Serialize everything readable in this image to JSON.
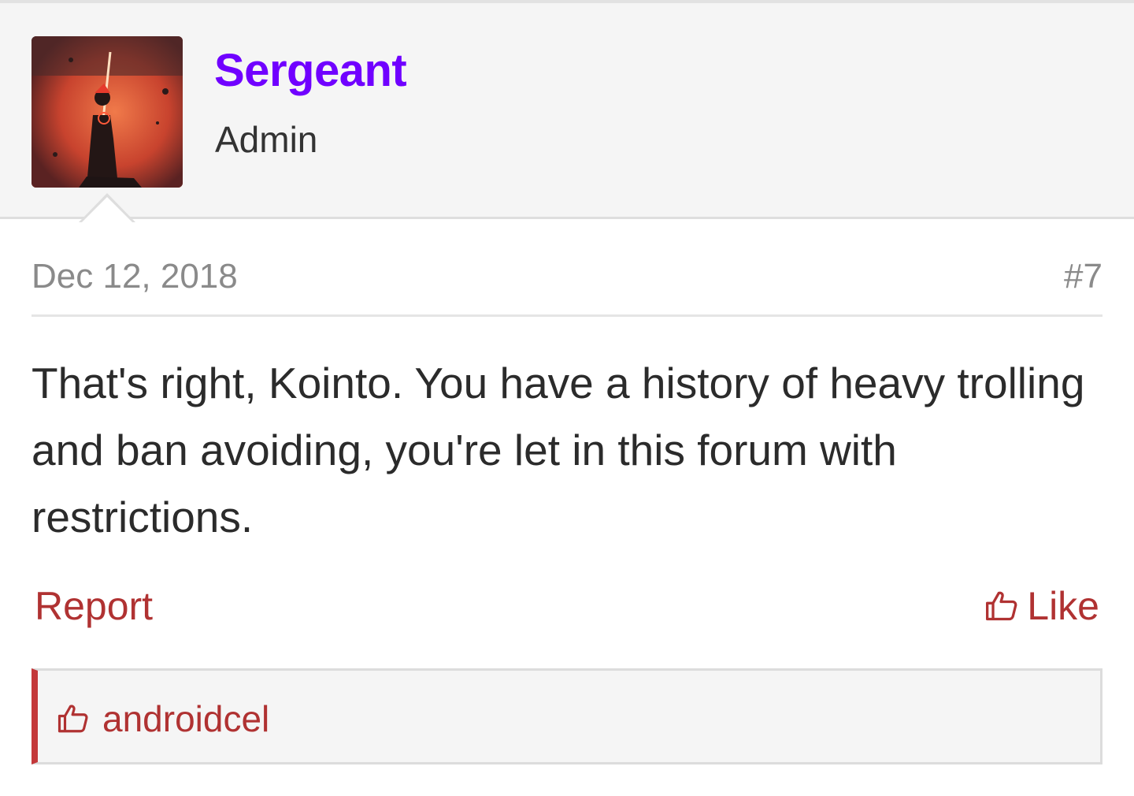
{
  "post": {
    "username": "Sergeant",
    "user_title": "Admin",
    "date": "Dec 12, 2018",
    "number": "#7",
    "message": "That's right, Kointo. You have a history of heavy trolling and ban avoiding, you're let in this forum with restrictions.",
    "report_label": "Report",
    "like_label": "Like"
  },
  "likes": {
    "users": [
      "androidcel"
    ]
  },
  "colors": {
    "username": "#7000ff",
    "link": "#b03232",
    "likes_accent": "#c3383a",
    "header_bg": "#f5f5f5"
  },
  "icons": {
    "like": "thumbs-up-icon",
    "avatar": "avatar-image"
  }
}
